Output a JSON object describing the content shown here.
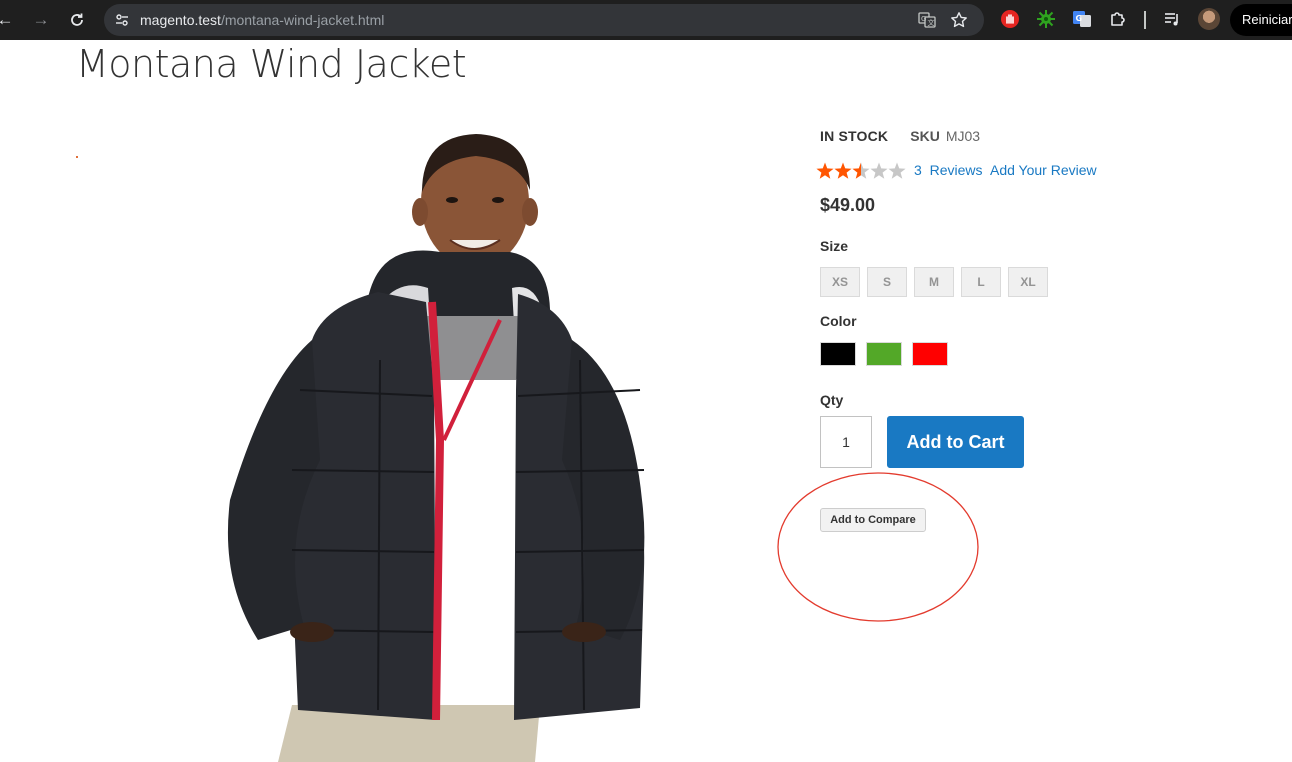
{
  "browser": {
    "url_host": "magento.test",
    "url_path": "/montana-wind-jacket.html",
    "restart_label": "Reiniciar",
    "icons": {
      "back": "arrow-left-icon",
      "forward": "arrow-right-icon",
      "reload": "reload-icon",
      "site_info": "tune-icon",
      "translate": "translate-icon",
      "bookmark": "star-icon",
      "extensions": [
        "red-hand-extension-icon",
        "green-bug-extension-icon",
        "google-translate-extension-icon",
        "puzzle-extensions-icon",
        "media-queue-icon"
      ]
    }
  },
  "product": {
    "title": "Montana Wind Jacket",
    "image_alt": "Man wearing black quilted jacket with red zipper",
    "stock": "IN STOCK",
    "sku_label": "SKU",
    "sku": "MJ03",
    "rating": {
      "stars_filled": 2.5,
      "stars_total": 5,
      "reviews_count": "3",
      "reviews_label": "Reviews",
      "add_review_label": "Add Your Review"
    },
    "price": "$49.00",
    "size": {
      "label": "Size",
      "options": [
        "XS",
        "S",
        "M",
        "L",
        "XL"
      ]
    },
    "color": {
      "label": "Color",
      "options": [
        {
          "name": "Black",
          "hex": "#000000"
        },
        {
          "name": "Green",
          "hex": "#53a828"
        },
        {
          "name": "Red",
          "hex": "#ff0000"
        }
      ]
    },
    "qty": {
      "label": "Qty",
      "value": "1"
    },
    "add_to_cart_label": "Add to Cart",
    "add_to_compare_label": "Add to Compare"
  },
  "colors": {
    "accent": "#1979c3",
    "star_filled": "#ff5501",
    "star_empty": "#c7c7c7",
    "annotation": "#e33b2e"
  }
}
